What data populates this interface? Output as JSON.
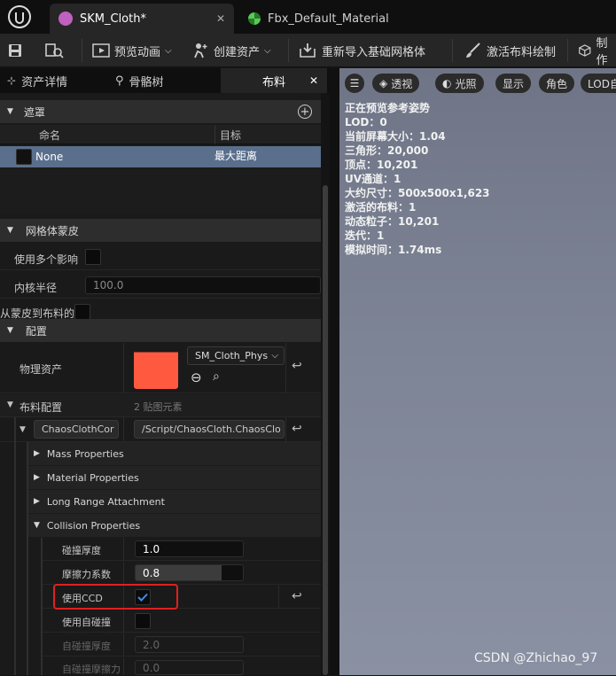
{
  "tabs": [
    {
      "label": "SKM_Cloth*",
      "close": "✕"
    },
    {
      "label": "Fbx_Default_Material"
    }
  ],
  "toolbar": {
    "preview_anim": "预览动画",
    "create_asset": "创建资产",
    "reimport": "重新导入基础网格体",
    "activate_cloth": "激活布料绘制",
    "make": "制作"
  },
  "panel_tabs": [
    {
      "label": "资产详情"
    },
    {
      "label": "骨骼树"
    },
    {
      "label": "布料",
      "close": "✕"
    }
  ],
  "mask": {
    "section": "遮罩",
    "col_name": "命名",
    "col_target": "目标",
    "row_name": "None",
    "row_target": "最大距离"
  },
  "mesh_skin": {
    "section": "网格体蒙皮",
    "multi_influence_label": "使用多个影响",
    "kernel_radius_label": "内核半径",
    "kernel_radius_value": "100.0",
    "skin_to_cloth_label": "从蒙皮到布料的平"
  },
  "config": {
    "section": "配置",
    "physics_asset_label": "物理资产",
    "physics_asset_value": "SM_Cloth_Phys"
  },
  "cloth_config": {
    "label": "布料配置",
    "count": "2 贴图元素",
    "class_name": "ChaosClothCor",
    "path": "/Script/ChaosCloth.ChaosClo",
    "categories": [
      "Mass Properties",
      "Material Properties",
      "Long Range Attachment",
      "Collision Properties"
    ],
    "collision": {
      "thickness_label": "碰撞厚度",
      "thickness_value": "1.0",
      "friction_label": "摩擦力系数",
      "friction_value": "0.8",
      "friction_fill": 0.8,
      "ccd_label": "使用CCD",
      "ccd_checked": true,
      "self_collision_label": "使用自碰撞",
      "self_thickness_label": "自碰撞厚度",
      "self_thickness_value": "2.0",
      "self_friction_label": "自碰撞摩擦力",
      "self_friction_value": "0.0"
    }
  },
  "viewport": {
    "buttons": [
      "透视",
      "光照",
      "显示",
      "角色",
      "LOD自"
    ],
    "stats": [
      "正在预览参考姿势",
      "LOD：0",
      "当前屏幕大小：1.04",
      "三角形：20,000",
      "顶点：10,201",
      "UV通道：1",
      "大约尺寸：500x500x1,623",
      "激活的布料：1",
      "动态粒子：10,201",
      "迭代：1",
      "模拟时间：1.74ms"
    ],
    "watermark": "CSDN @Zhichao_97"
  },
  "colors": {
    "highlight": "#e02020",
    "selection": "#5a6f8c",
    "accent": "#ff5533"
  }
}
